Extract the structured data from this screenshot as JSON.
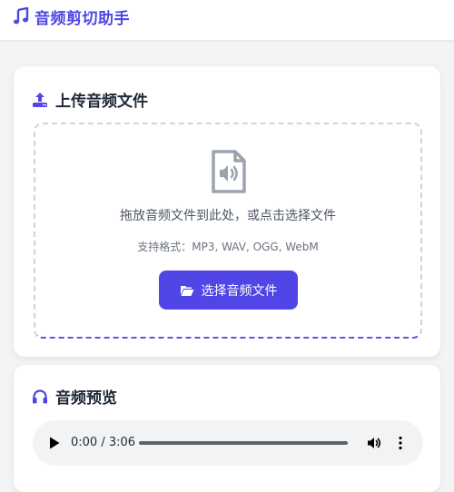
{
  "app": {
    "title": "音频剪切助手",
    "brand_icon": "music-note-icon",
    "accent_color": "#4f46e5"
  },
  "upload_section": {
    "title": "上传音频文件",
    "icon": "upload-icon",
    "drop_text": "拖放音频文件到此处，或点击选择文件",
    "formats_text": "支持格式：MP3, WAV, OGG, WebM",
    "file_icon": "audio-file-icon",
    "button": {
      "label": "选择音频文件",
      "icon": "folder-open-icon"
    }
  },
  "preview_section": {
    "title": "音频预览",
    "icon": "headphones-icon",
    "player": {
      "time": "0:00 / 3:06",
      "progress": 0,
      "play_icon": "play-icon",
      "volume_icon": "volume-icon",
      "more_icon": "more-vertical-icon"
    }
  }
}
